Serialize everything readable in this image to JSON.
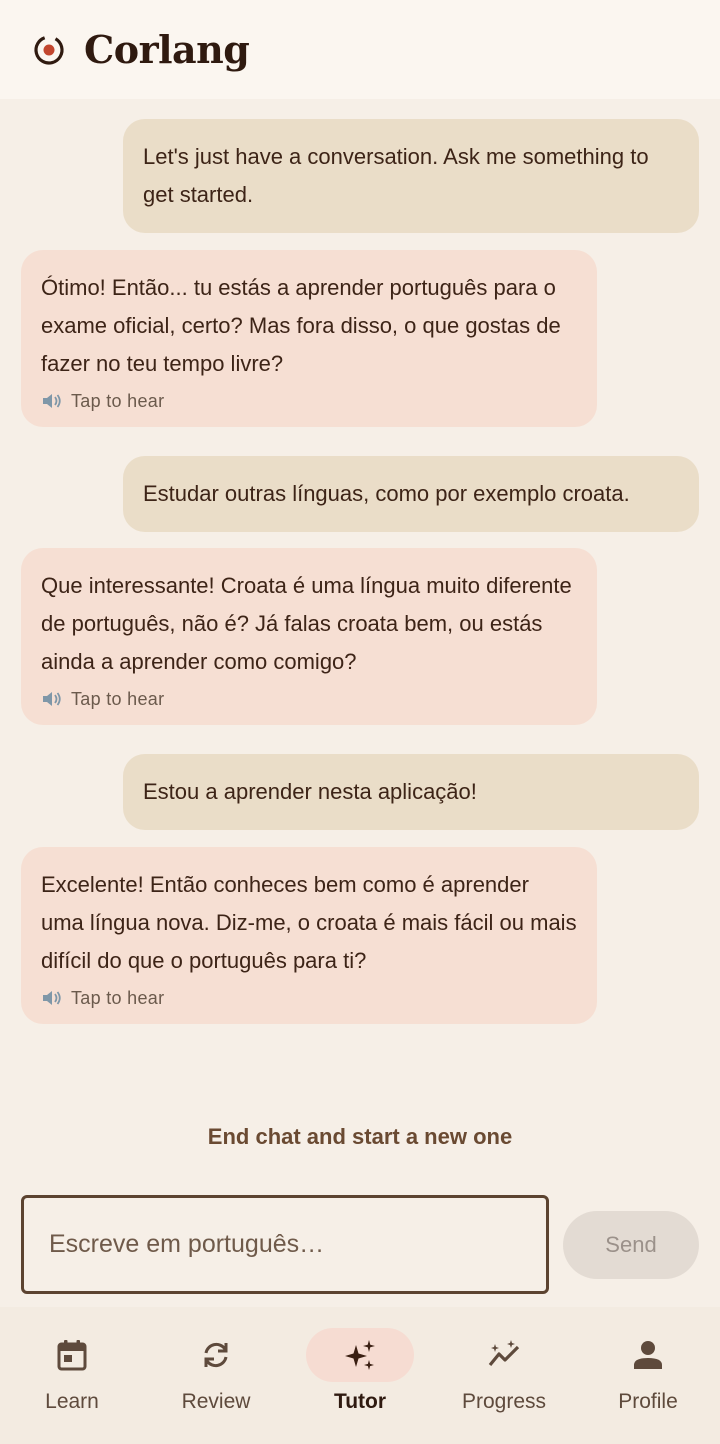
{
  "header": {
    "title": "Corlang",
    "logo_icon": "target-logo-icon"
  },
  "messages": [
    {
      "role": "user",
      "text": "Let's just have a conversation. Ask me something to get started."
    },
    {
      "role": "tutor",
      "text": "Ótimo! Então... tu estás a aprender português para o exame oficial, certo? Mas fora disso, o que gostas de fazer no teu tempo livre?",
      "action": "Tap to hear"
    },
    {
      "role": "user",
      "text": "Estudar outras línguas, como por exemplo croata."
    },
    {
      "role": "tutor",
      "text": "Que interessante! Croata é uma língua muito diferente de português, não é? Já falas croata bem, ou estás ainda a aprender como comigo?",
      "action": "Tap to hear"
    },
    {
      "role": "user",
      "text": "Estou a aprender nesta aplicação!"
    },
    {
      "role": "tutor",
      "text": "Excelente! Então conheces bem como é aprender uma língua nova. Diz-me, o croata é mais fácil ou mais difícil do que o português para ti?",
      "action": "Tap to hear"
    }
  ],
  "end_chat_label": "End chat and start a new one",
  "composer": {
    "placeholder": "Escreve em português…",
    "value": "",
    "send_label": "Send"
  },
  "nav": [
    {
      "label": "Learn",
      "icon": "calendar-icon",
      "active": false
    },
    {
      "label": "Review",
      "icon": "sync-icon",
      "active": false
    },
    {
      "label": "Tutor",
      "icon": "sparkle-icon",
      "active": true
    },
    {
      "label": "Progress",
      "icon": "trend-icon",
      "active": false
    },
    {
      "label": "Profile",
      "icon": "person-icon",
      "active": false
    }
  ],
  "colors": {
    "background": "#f6efe7",
    "user_bubble": "#eaddc8",
    "tutor_bubble": "#f6dfd3",
    "text": "#3d2417",
    "active_nav_pill": "#f6dcd2"
  }
}
